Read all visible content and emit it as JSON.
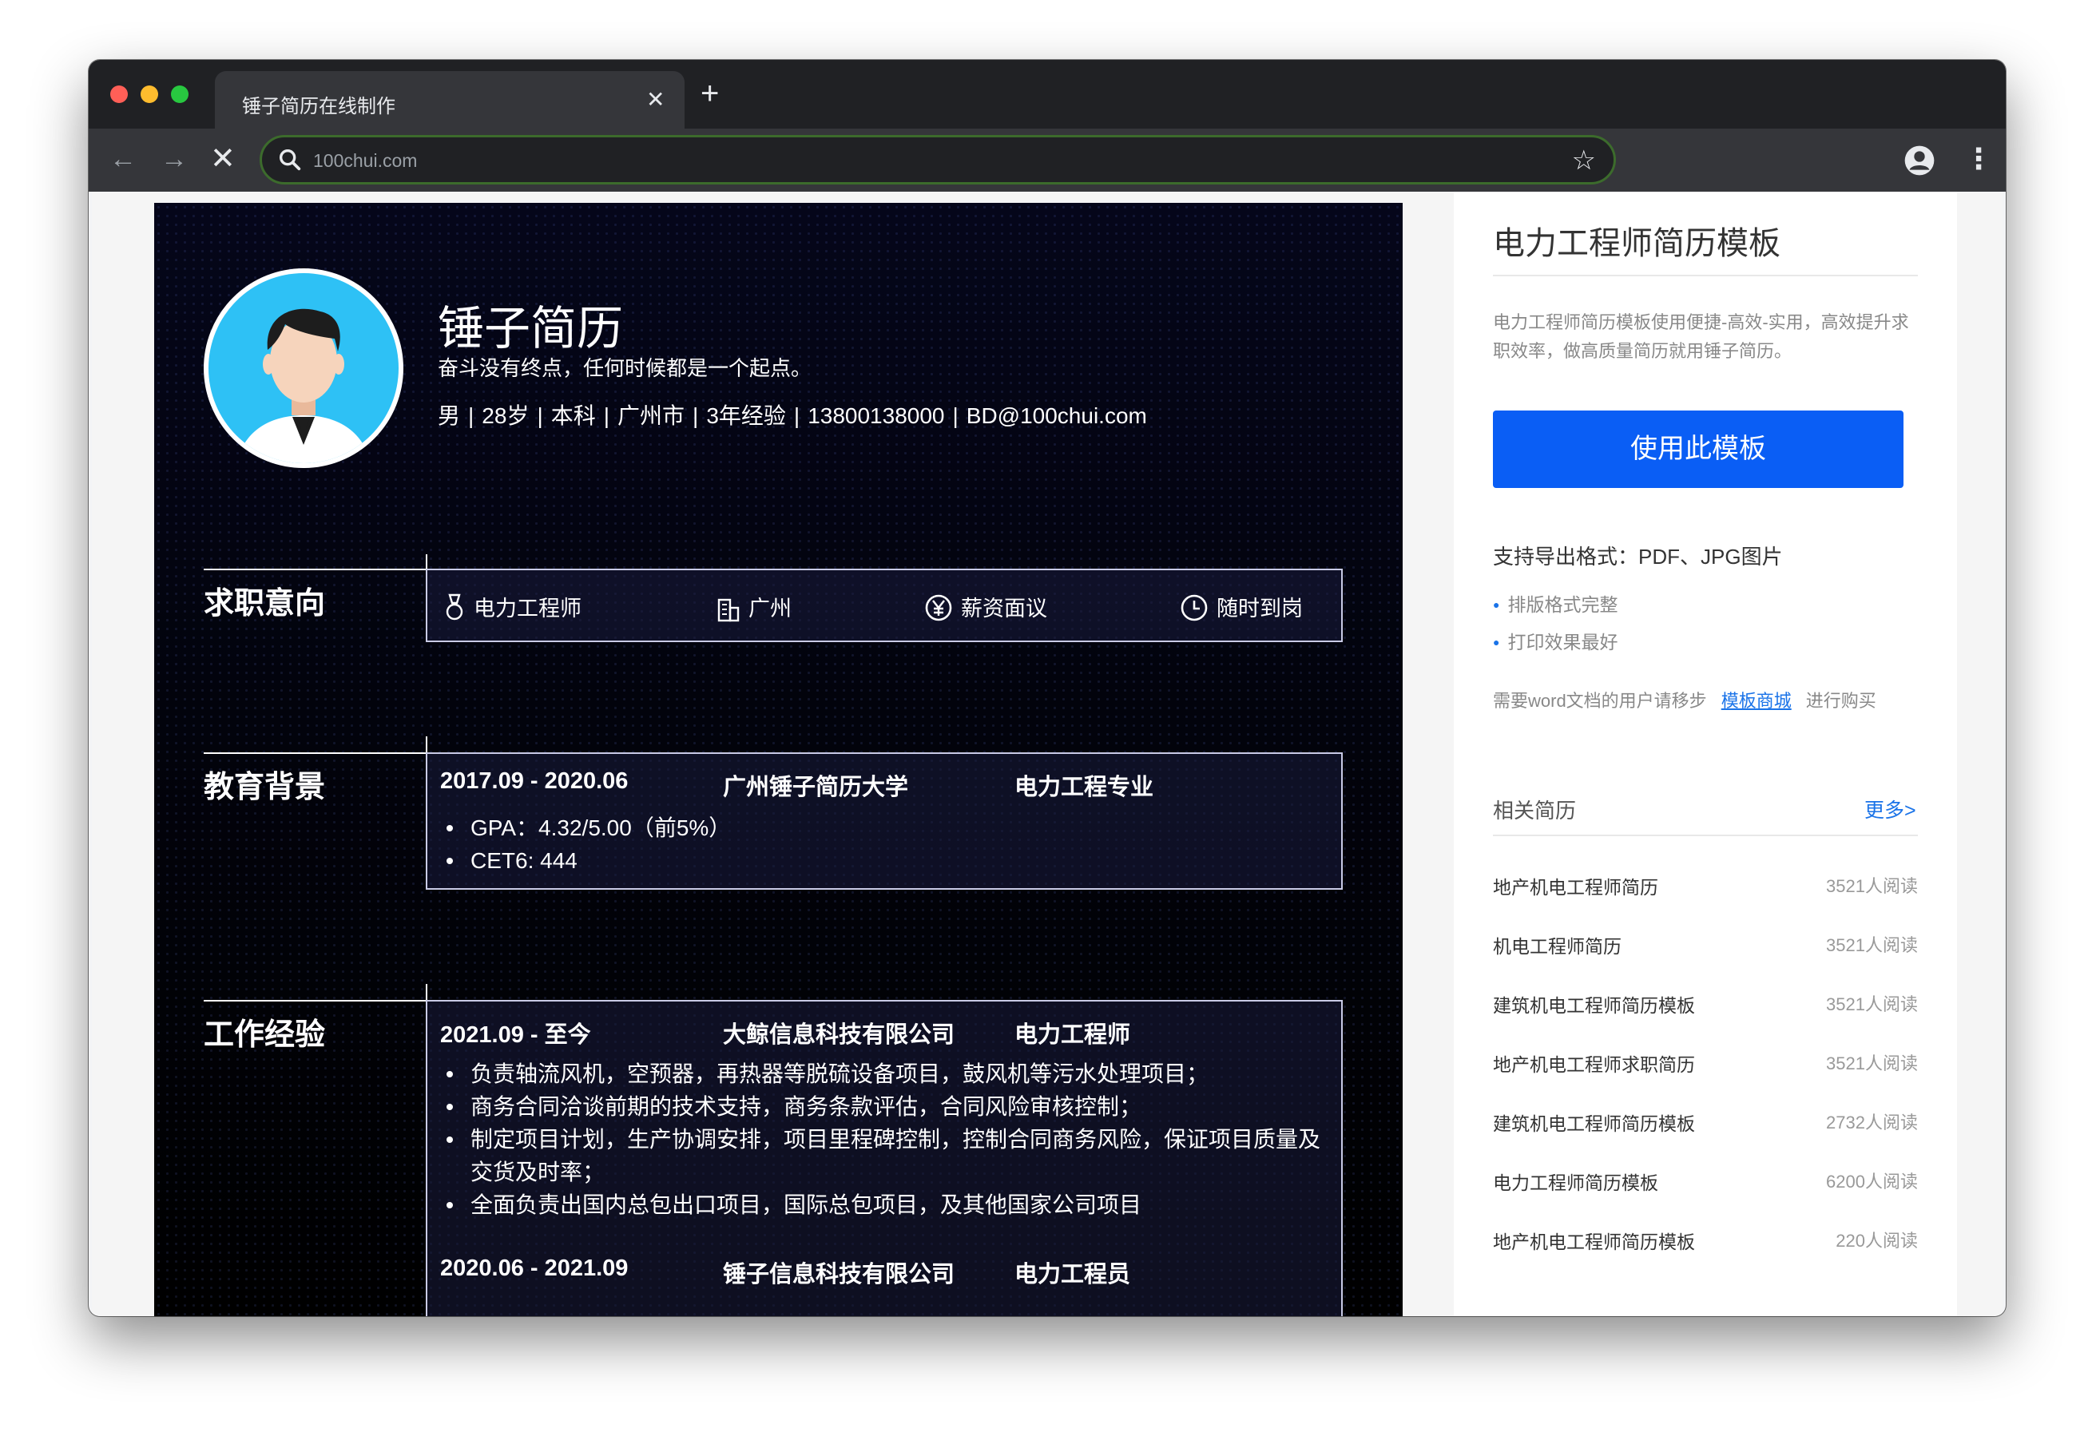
{
  "browser": {
    "tab_title": "锤子简历在线制作",
    "tab_close": "✕",
    "new_tab": "+",
    "url": "100chui.com",
    "back": "←",
    "forward": "→",
    "stop": "✕",
    "star": "☆",
    "menu": "⋮"
  },
  "resume": {
    "name": "锤子简历",
    "motto": "奋斗没有终点，任何时候都是一个起点。",
    "info": [
      "男",
      "28岁",
      "本科",
      "广州市",
      "3年经验",
      "13800138000",
      "BD@100chui.com"
    ],
    "info_sep": "|",
    "sections": {
      "intent": {
        "title": "求职意向",
        "items": [
          {
            "icon": "medal-icon",
            "label": "电力工程师"
          },
          {
            "icon": "building-icon",
            "label": "广州"
          },
          {
            "icon": "yen-icon",
            "label": "薪资面议"
          },
          {
            "icon": "clock-icon",
            "label": "随时到岗"
          }
        ]
      },
      "education": {
        "title": "教育背景",
        "period": "2017.09 - 2020.06",
        "school": "广州锤子简历大学",
        "major": "电力工程专业",
        "bullets": [
          "GPA：4.32/5.00（前5%）",
          "CET6: 444"
        ]
      },
      "experience": {
        "title": "工作经验",
        "jobs": [
          {
            "period": "2021.09 - 至今",
            "company": "大鲸信息科技有限公司",
            "role": "电力工程师",
            "bullets": [
              "负责轴流风机，空预器，再热器等脱硫设备项目，鼓风机等污水处理项目；",
              "商务合同洽谈前期的技术支持，商务条款评估，合同风险审核控制；",
              "制定项目计划，生产协调安排，项目里程碑控制，控制合同商务风险，保证项目质量及交货及时率；",
              "全面负责出国内总包出口项目，国际总包项目，及其他国家公司项目"
            ]
          },
          {
            "period": "2020.06 - 2021.09",
            "company": "锤子信息科技有限公司",
            "role": "电力工程员"
          }
        ]
      }
    }
  },
  "sidebar": {
    "title": "电力工程师简历模板",
    "description": "电力工程师简历模板使用便捷-高效-实用，高效提升求职效率，做高质量简历就用锤子简历。",
    "use_button": "使用此模板",
    "export_formats": "支持导出格式：PDF、JPG图片",
    "features": [
      "排版格式完整",
      "打印效果最好"
    ],
    "word_note_pre": "需要word文档的用户请移步",
    "word_note_link": "模板商城",
    "word_note_post": "进行购买",
    "related_title": "相关简历",
    "more_label": "更多>",
    "related": [
      {
        "title": "地产机电工程师简历",
        "reads": "3521人阅读"
      },
      {
        "title": "机电工程师简历",
        "reads": "3521人阅读"
      },
      {
        "title": "建筑机电工程师简历模板",
        "reads": "3521人阅读"
      },
      {
        "title": "地产机电工程师求职简历",
        "reads": "3521人阅读"
      },
      {
        "title": "建筑机电工程师简历模板",
        "reads": "2732人阅读"
      },
      {
        "title": "电力工程师简历模板",
        "reads": "6200人阅读"
      },
      {
        "title": "地产机电工程师简历模板",
        "reads": "220人阅读"
      }
    ]
  },
  "colors": {
    "accent_blue": "#0a5ef5",
    "stripe_blue": "#1424e0",
    "link_blue": "#1a73e8",
    "resume_bg": "#03030a"
  }
}
